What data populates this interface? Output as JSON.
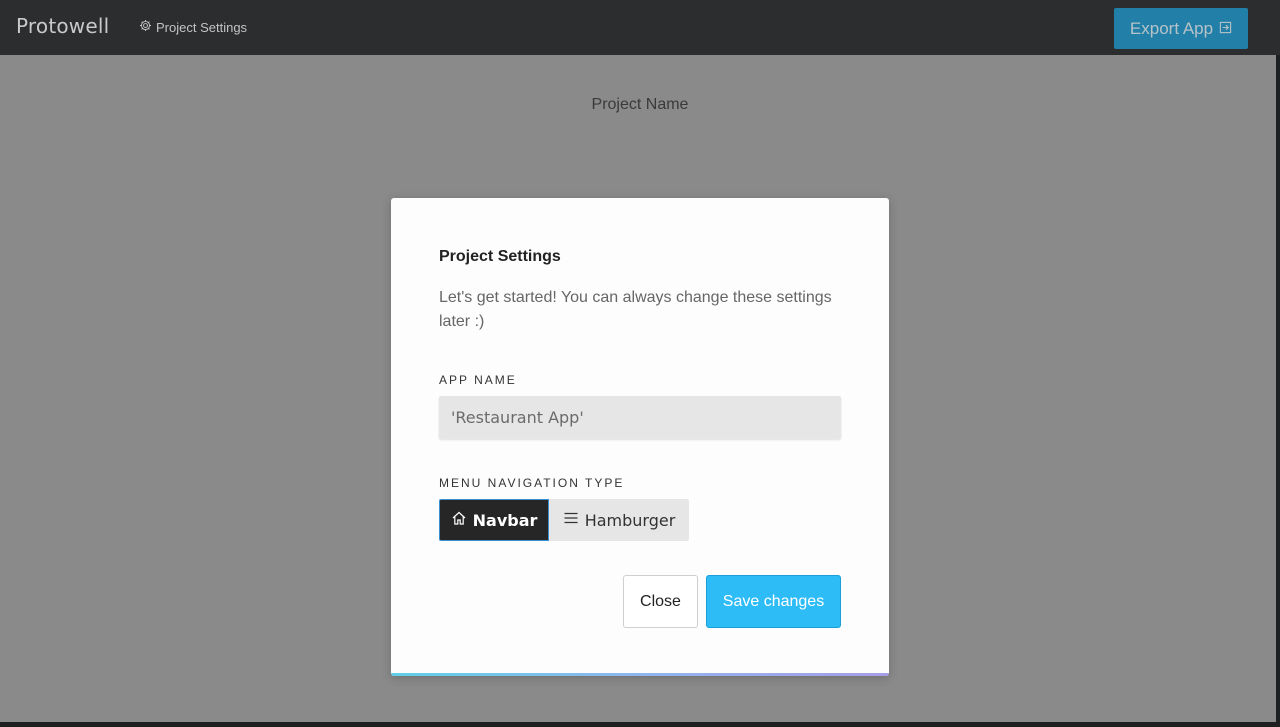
{
  "topbar": {
    "brand": "Protowell",
    "settings_link": "Project Settings",
    "settings_icon": "gear-icon",
    "export_label": "Export App",
    "export_icon": "export-icon"
  },
  "main": {
    "project_name": "Project Name"
  },
  "modal": {
    "title": "Project Settings",
    "description": "Let's get started! You can always change these settings later :)",
    "app_name_label": "APP NAME",
    "app_name_value": "'Restaurant App'",
    "menu_nav_label": "MENU NAVIGATION TYPE",
    "nav_options": [
      {
        "label": "Navbar",
        "icon": "home-icon",
        "selected": true
      },
      {
        "label": "Hamburger",
        "icon": "hamburger-icon",
        "selected": false
      }
    ],
    "close_label": "Close",
    "save_label": "Save changes"
  },
  "colors": {
    "accent": "#2ebcf7",
    "export_button": "#1f9bd1",
    "navbar_bg": "#2b2d2e",
    "overlay": "#8a8a8a"
  }
}
